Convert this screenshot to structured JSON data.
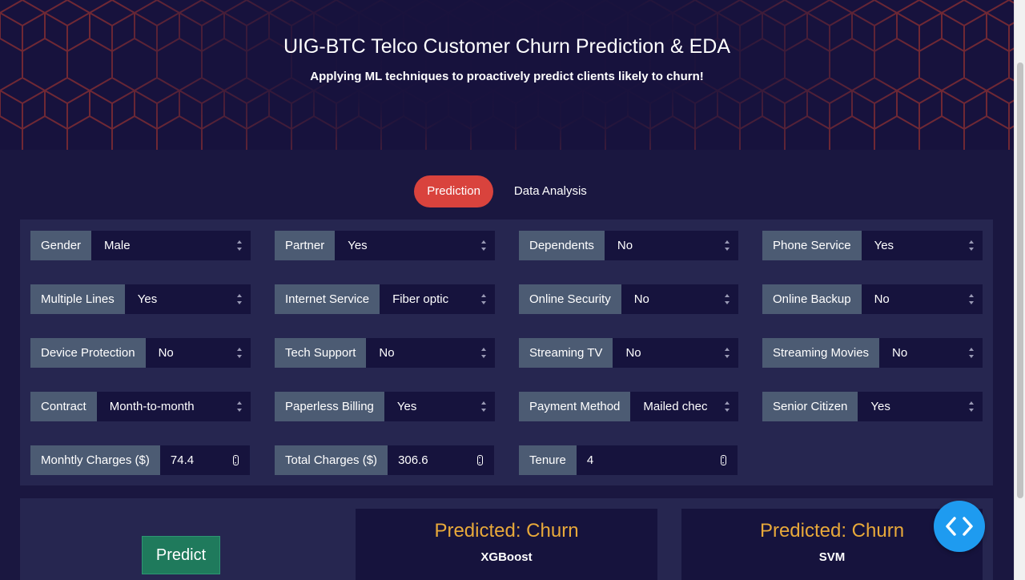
{
  "header": {
    "title": "UIG-BTC Telco Customer Churn Prediction & EDA",
    "subtitle": "Applying ML techniques to proactively predict clients likely to churn!"
  },
  "tabs": [
    {
      "label": "Prediction",
      "active": true
    },
    {
      "label": "Data Analysis",
      "active": false
    }
  ],
  "form": {
    "gender": {
      "label": "Gender",
      "value": "Male"
    },
    "partner": {
      "label": "Partner",
      "value": "Yes"
    },
    "dependents": {
      "label": "Dependents",
      "value": "No"
    },
    "phone_service": {
      "label": "Phone Service",
      "value": "Yes"
    },
    "multiple_lines": {
      "label": "Multiple Lines",
      "value": "Yes"
    },
    "internet_service": {
      "label": "Internet Service",
      "value": "Fiber optic"
    },
    "online_security": {
      "label": "Online Security",
      "value": "No"
    },
    "online_backup": {
      "label": "Online Backup",
      "value": "No"
    },
    "device_protection": {
      "label": "Device Protection",
      "value": "No"
    },
    "tech_support": {
      "label": "Tech Support",
      "value": "No"
    },
    "streaming_tv": {
      "label": "Streaming TV",
      "value": "No"
    },
    "streaming_movies": {
      "label": "Streaming Movies",
      "value": "No"
    },
    "contract": {
      "label": "Contract",
      "value": "Month-to-month"
    },
    "paperless_billing": {
      "label": "Paperless Billing",
      "value": "Yes"
    },
    "payment_method": {
      "label": "Payment Method",
      "value": "Mailed chec"
    },
    "senior_citizen": {
      "label": "Senior Citizen",
      "value": "Yes"
    },
    "monthly_charges": {
      "label": "Monhtly Charges ($)",
      "value": "74.4"
    },
    "total_charges": {
      "label": "Total Charges ($)",
      "value": "306.6"
    },
    "tenure": {
      "label": "Tenure",
      "value": "4"
    }
  },
  "actions": {
    "predict_label": "Predict"
  },
  "results": [
    {
      "prediction": "Predicted: Churn",
      "model": "XGBoost"
    },
    {
      "prediction": "Predicted: Churn",
      "model": "SVM"
    }
  ],
  "colors": {
    "background": "#1a1740",
    "panel": "#262650",
    "active_tab": "#d9433d",
    "label_bg": "#4c5b73",
    "prediction_text": "#e8a93a",
    "predict_button": "#1f7a5c",
    "fab": "#1e9bf0"
  },
  "icons": {
    "fab": "code-brackets-icon"
  }
}
